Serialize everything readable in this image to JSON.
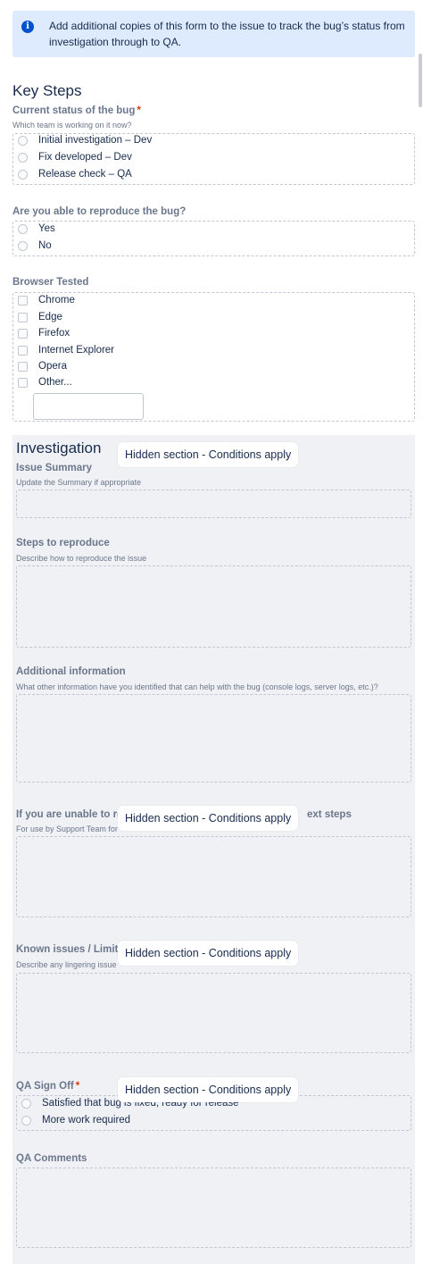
{
  "info_banner": {
    "icon": "info-icon",
    "text": "Add additional copies of this form to the issue to track the bug’s status from investigation through to QA."
  },
  "key_steps": {
    "title": "Key Steps",
    "status": {
      "label": "Current status of the bug",
      "required": "*",
      "description": "Which team is working on it now?",
      "options": [
        "Initial investigation – Dev",
        "Fix developed – Dev",
        "Release check – QA"
      ]
    },
    "reproduce": {
      "label": "Are you able to reproduce the bug?",
      "options": [
        "Yes",
        "No"
      ]
    },
    "browser": {
      "label": "Browser Tested",
      "options": [
        "Chrome",
        "Edge",
        "Firefox",
        "Internet Explorer",
        "Opera",
        "Other..."
      ],
      "other_value": ""
    }
  },
  "investigation": {
    "title": "Investigation",
    "hidden_badge": "Hidden section - Conditions apply",
    "issue_summary": {
      "label": "Issue Summary",
      "description": "Update the Summary if appropriate",
      "value": ""
    },
    "steps": {
      "label": "Steps to reproduce",
      "description": "Describe how to reproduce the issue",
      "value": ""
    },
    "additional": {
      "label": "Additional information",
      "description": "What other information have you identified that can help with the bug (console logs, server logs, etc.)?",
      "value": ""
    },
    "unable": {
      "label_start": "If you are unable to re",
      "label_end": "ext steps",
      "description": "For use by Support Team for",
      "value": ""
    },
    "known_issues": {
      "label": "Known issues / Limita",
      "description": "Describe any lingering issue",
      "value": ""
    },
    "qa_signoff": {
      "label": "QA Sign Off",
      "required": "*",
      "options": [
        "Satisfied that bug is fixed, ready for release",
        "More work required"
      ]
    },
    "qa_comments": {
      "label": "QA Comments",
      "value": ""
    }
  }
}
